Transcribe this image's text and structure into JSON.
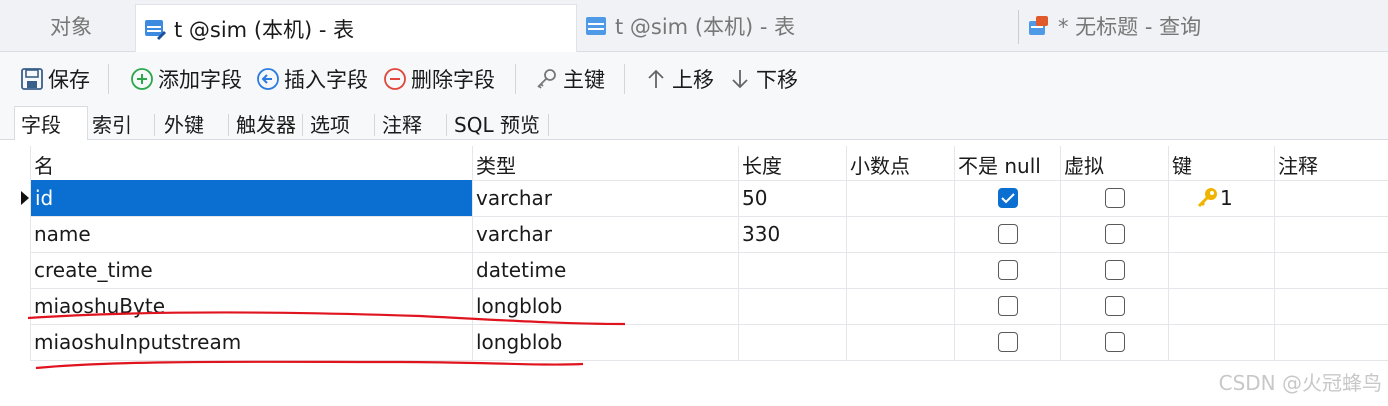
{
  "tabs": [
    {
      "label": "对象",
      "active": false
    },
    {
      "label": "t @sim (本机) - 表",
      "active": true
    },
    {
      "label": "t @sim (本机) - 表",
      "active": false
    },
    {
      "label": "* 无标题 - 查询",
      "active": false
    }
  ],
  "toolbar": {
    "save": "保存",
    "add_field": "添加字段",
    "insert_field": "插入字段",
    "delete_field": "删除字段",
    "primary_key": "主键",
    "move_up": "上移",
    "move_down": "下移"
  },
  "subtabs": [
    "字段",
    "索引",
    "外键",
    "触发器",
    "选项",
    "注释",
    "SQL 预览"
  ],
  "columns": [
    "名",
    "类型",
    "长度",
    "小数点",
    "不是 null",
    "虚拟",
    "键",
    "注释"
  ],
  "rows": [
    {
      "name": "id",
      "type": "varchar",
      "length": "50",
      "decimals": "",
      "not_null": true,
      "virtual": false,
      "key": "1",
      "comment": ""
    },
    {
      "name": "name",
      "type": "varchar",
      "length": "330",
      "decimals": "",
      "not_null": false,
      "virtual": false,
      "key": "",
      "comment": ""
    },
    {
      "name": "create_time",
      "type": "datetime",
      "length": "",
      "decimals": "",
      "not_null": false,
      "virtual": false,
      "key": "",
      "comment": ""
    },
    {
      "name": "miaoshuByte",
      "type": "longblob",
      "length": "",
      "decimals": "",
      "not_null": false,
      "virtual": false,
      "key": "",
      "comment": ""
    },
    {
      "name": "miaoshuInputstream",
      "type": "longblob",
      "length": "",
      "decimals": "",
      "not_null": false,
      "virtual": false,
      "key": "",
      "comment": ""
    }
  ],
  "watermark": "CSDN @火冠蜂鸟",
  "colors": {
    "selection": "#0a6fd1",
    "annotation": "#e0141e",
    "key": "#f0b400"
  }
}
